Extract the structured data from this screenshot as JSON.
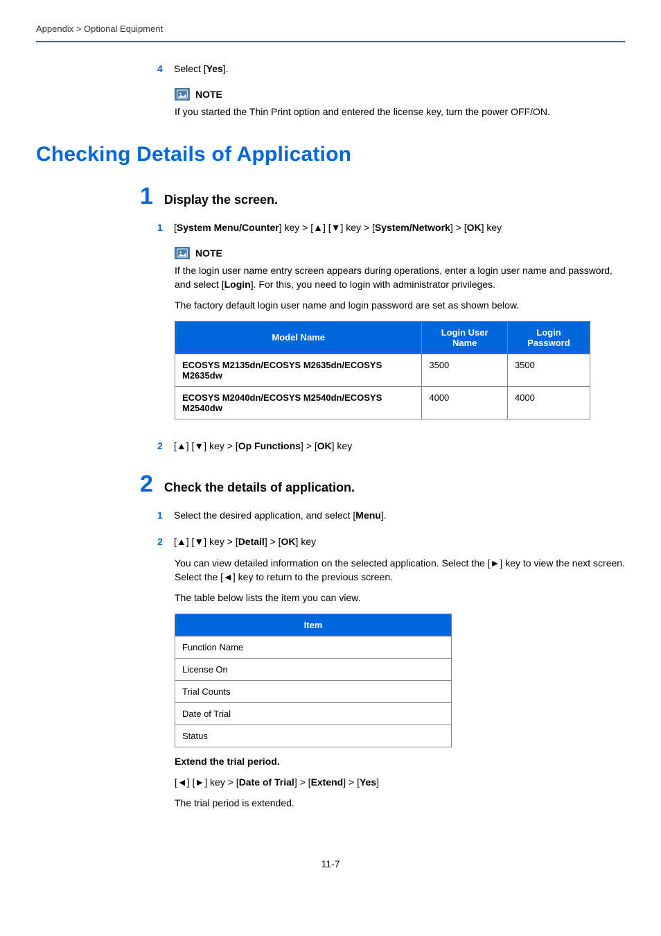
{
  "breadcrumb": "Appendix > Optional Equipment",
  "top_substep": {
    "num": "4",
    "parts": [
      "Select [",
      "Yes",
      "]."
    ]
  },
  "top_note": {
    "label": "NOTE",
    "body": "If you started the Thin Print option and entered the license key, turn the power OFF/ON."
  },
  "section_title": "Checking Details of Application",
  "step1": {
    "num": "1",
    "title": "Display the screen.",
    "sub1": {
      "num": "1",
      "parts": [
        "[",
        "System Menu/Counter",
        "] key > [▲] [▼] key > [",
        "System/Network",
        "] > [",
        "OK",
        "] key"
      ]
    },
    "note": {
      "label": "NOTE",
      "line1_parts": [
        "If the login user name entry screen appears during operations, enter a login user name and password, and select [",
        "Login",
        "]. For this, you need to login with administrator privileges."
      ],
      "line2": "The factory default login user name and login password are set as shown below."
    },
    "table": {
      "headers": [
        "Model Name",
        "Login User Name",
        "Login Password"
      ],
      "rows": [
        {
          "model": "ECOSYS M2135dn/ECOSYS M2635dn/ECOSYS M2635dw",
          "user": "3500",
          "pass": "3500"
        },
        {
          "model": "ECOSYS M2040dn/ECOSYS M2540dn/ECOSYS M2540dw",
          "user": "4000",
          "pass": "4000"
        }
      ]
    },
    "sub2": {
      "num": "2",
      "parts": [
        "[▲] [▼] key > [",
        "Op Functions",
        "] > [",
        "OK",
        "] key"
      ]
    }
  },
  "step2": {
    "num": "2",
    "title": "Check the details of application.",
    "sub1": {
      "num": "1",
      "parts": [
        "Select the desired application, and select [",
        "Menu",
        "]."
      ]
    },
    "sub2": {
      "num": "2",
      "parts": [
        "[▲] [▼] key > [",
        "Detail",
        "] > [",
        "OK",
        "] key"
      ]
    },
    "para1": "You can view detailed information on the selected application. Select the [►] key to view the next screen. Select the [◄] key to return to the previous screen.",
    "para2": "The table below lists the item you can view.",
    "items_header": "Item",
    "items": [
      "Function Name",
      "License On",
      "Trial Counts",
      "Date of Trial",
      "Status"
    ],
    "extend_title": "Extend the trial period.",
    "extend_parts": [
      "[◄] [►] key > [",
      "Date of Trial",
      "] > [",
      "Extend",
      "] > [",
      "Yes",
      "]"
    ],
    "extend_result": "The trial period is extended."
  },
  "page_number": "11-7"
}
